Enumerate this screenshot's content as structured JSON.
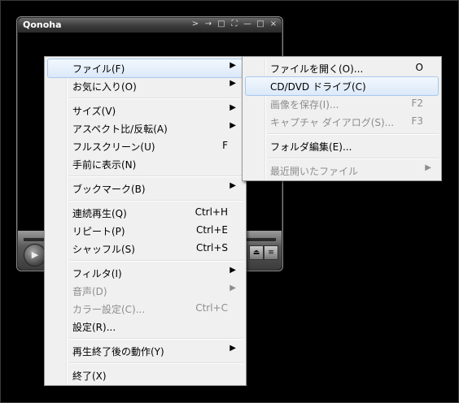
{
  "player": {
    "title": "Qonoha",
    "titlebar_buttons": [
      ">",
      "→",
      "□",
      "⛶",
      "—",
      "□",
      "×"
    ]
  },
  "main_menu": {
    "items": [
      {
        "label": "ファイル(F)",
        "shortcut": "",
        "submenu": true,
        "disabled": false,
        "highlighted": true
      },
      {
        "label": "お気に入り(O)",
        "shortcut": "",
        "submenu": true,
        "disabled": false,
        "highlighted": false
      },
      {
        "label": "サイズ(V)",
        "shortcut": "",
        "submenu": true,
        "disabled": false,
        "highlighted": false
      },
      {
        "label": "アスペクト比/反転(A)",
        "shortcut": "",
        "submenu": true,
        "disabled": false,
        "highlighted": false
      },
      {
        "label": "フルスクリーン(U)",
        "shortcut": "F",
        "submenu": false,
        "disabled": false,
        "highlighted": false
      },
      {
        "label": "手前に表示(N)",
        "shortcut": "",
        "submenu": false,
        "disabled": false,
        "highlighted": false
      },
      {
        "label": "ブックマーク(B)",
        "shortcut": "",
        "submenu": true,
        "disabled": false,
        "highlighted": false
      },
      {
        "label": "連続再生(Q)",
        "shortcut": "Ctrl+H",
        "submenu": false,
        "disabled": false,
        "highlighted": false
      },
      {
        "label": "リピート(P)",
        "shortcut": "Ctrl+E",
        "submenu": false,
        "disabled": false,
        "highlighted": false
      },
      {
        "label": "シャッフル(S)",
        "shortcut": "Ctrl+S",
        "submenu": false,
        "disabled": false,
        "highlighted": false
      },
      {
        "label": "フィルタ(I)",
        "shortcut": "",
        "submenu": true,
        "disabled": false,
        "highlighted": false
      },
      {
        "label": "音声(D)",
        "shortcut": "",
        "submenu": true,
        "disabled": true,
        "highlighted": false
      },
      {
        "label": "カラー設定(C)...",
        "shortcut": "Ctrl+C",
        "submenu": false,
        "disabled": true,
        "highlighted": false
      },
      {
        "label": "設定(R)...",
        "shortcut": "",
        "submenu": false,
        "disabled": false,
        "highlighted": false
      },
      {
        "label": "再生終了後の動作(Y)",
        "shortcut": "",
        "submenu": true,
        "disabled": false,
        "highlighted": false
      },
      {
        "label": "終了(X)",
        "shortcut": "",
        "submenu": false,
        "disabled": false,
        "highlighted": false
      }
    ]
  },
  "file_menu": {
    "items": [
      {
        "label": "ファイルを開く(O)...",
        "shortcut": "O",
        "submenu": false,
        "disabled": false,
        "highlighted": false
      },
      {
        "label": "CD/DVD ドライブ(C)",
        "shortcut": "",
        "submenu": false,
        "disabled": false,
        "highlighted": true
      },
      {
        "label": "画像を保存(I)...",
        "shortcut": "F2",
        "submenu": false,
        "disabled": true,
        "highlighted": false
      },
      {
        "label": "キャプチャ ダイアログ(S)...",
        "shortcut": "F3",
        "submenu": false,
        "disabled": true,
        "highlighted": false
      },
      {
        "label": "フォルダ編集(E)...",
        "shortcut": "",
        "submenu": false,
        "disabled": false,
        "highlighted": false
      },
      {
        "label": "最近開いたファイル",
        "shortcut": "",
        "submenu": true,
        "disabled": true,
        "highlighted": false
      }
    ]
  },
  "colors": {
    "menu_bg": "#f0f0f0",
    "highlight_border": "#a8c8ed",
    "disabled_text": "#8d8d8d"
  }
}
